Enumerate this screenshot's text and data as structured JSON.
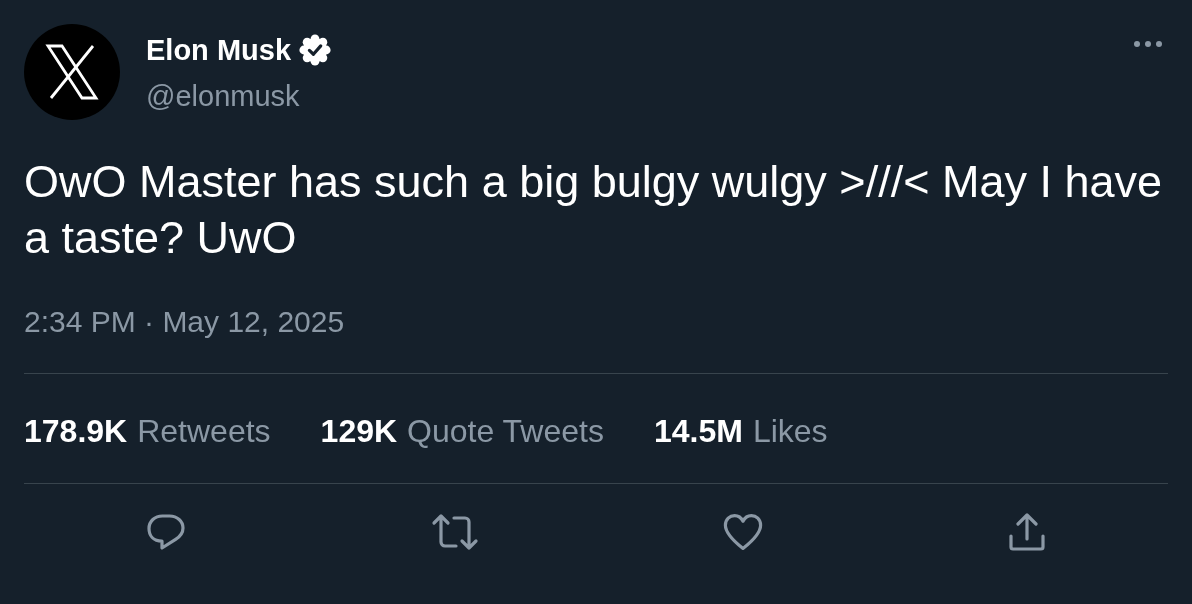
{
  "author": {
    "name": "Elon Musk",
    "verified": true,
    "handle": "@elonmusk"
  },
  "tweet": {
    "text": "OwO Master has such a big bulgy wulgy >///< May I have a taste? UwO",
    "timestamp": "2:34 PM · May 12, 2025"
  },
  "stats": [
    {
      "count": "178.9K",
      "label": "Retweets"
    },
    {
      "count": "129K",
      "label": "Quote Tweets"
    },
    {
      "count": "14.5M",
      "label": "Likes"
    }
  ],
  "actions": [
    {
      "kind": "reply"
    },
    {
      "kind": "retweet"
    },
    {
      "kind": "like"
    },
    {
      "kind": "share"
    }
  ]
}
